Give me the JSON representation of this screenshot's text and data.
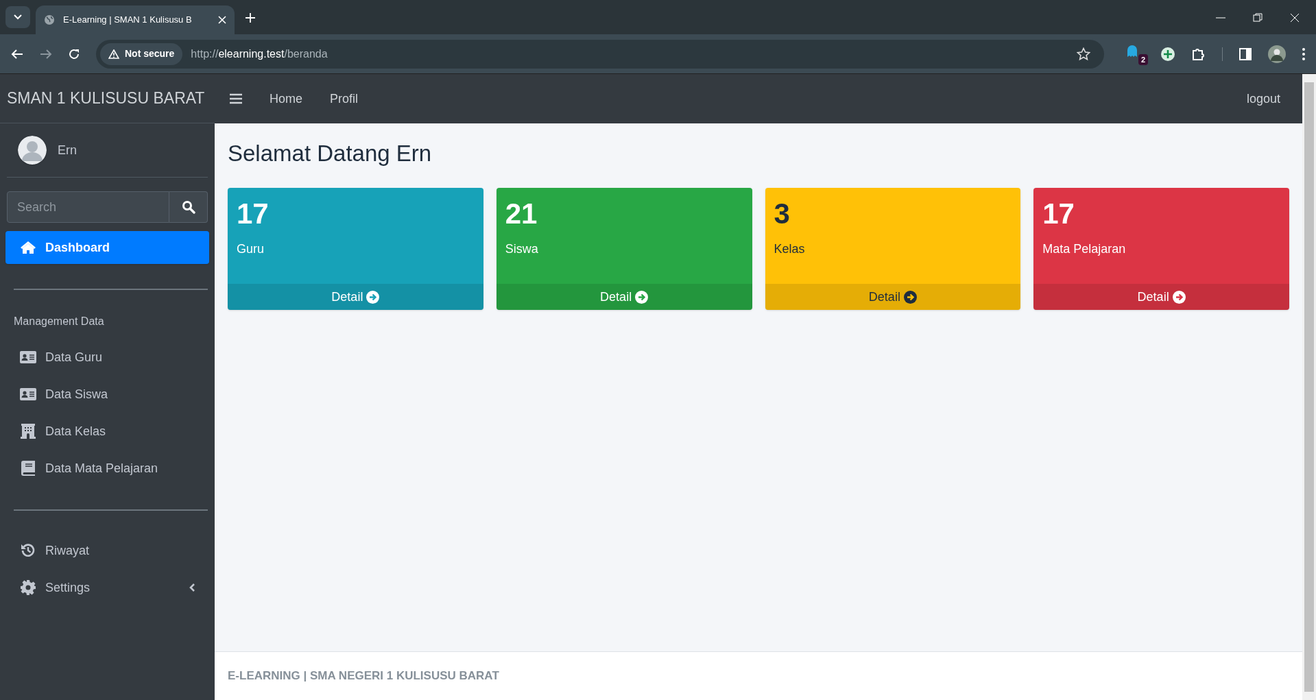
{
  "browser": {
    "tab_title": "E-Learning | SMAN 1 Kulisusu B",
    "security": "Not secure",
    "url_scheme": "http://",
    "url_host": "elearning.test",
    "url_path": "/beranda",
    "extension_badge": "2"
  },
  "app": {
    "brand": "SMAN 1 KULISUSU BARAT",
    "user": "Ern",
    "search": {
      "placeholder": "Search"
    },
    "nav_groups": [
      {
        "items": [
          {
            "label": "Dashboard",
            "selected": true,
            "has_submenu": false
          }
        ]
      },
      {
        "heading": "Management Data",
        "items": [
          {
            "label": "Data Guru",
            "selected": false,
            "has_submenu": false
          },
          {
            "label": "Data Siswa",
            "selected": false,
            "has_submenu": false
          },
          {
            "label": "Data Kelas",
            "selected": false,
            "has_submenu": false
          },
          {
            "label": "Data Mata Pelajaran",
            "selected": false,
            "has_submenu": false
          }
        ]
      },
      {
        "items": [
          {
            "label": "Riwayat",
            "selected": false,
            "has_submenu": false
          },
          {
            "label": "Settings",
            "selected": false,
            "has_submenu": true
          }
        ]
      }
    ],
    "top_links": [
      "Home",
      "Profil"
    ],
    "logout": "logout",
    "title": "Selamat Datang Ern",
    "cards": [
      {
        "count": "17",
        "label": "Guru",
        "link": "Detail",
        "color": "#17a2b8"
      },
      {
        "count": "21",
        "label": "Siswa",
        "link": "Detail",
        "color": "#28a745"
      },
      {
        "count": "3",
        "label": "Kelas",
        "link": "Detail",
        "color": "#ffc107"
      },
      {
        "count": "17",
        "label": "Mata Pelajaran",
        "link": "Detail",
        "color": "#dc3545"
      }
    ],
    "footer": "E-LEARNING | SMA NEGERI 1 KULISUSU BARAT"
  }
}
